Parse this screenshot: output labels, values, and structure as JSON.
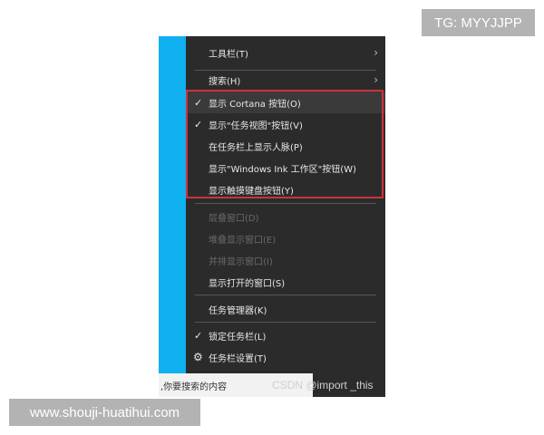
{
  "watermarks": {
    "top_right": "TG: MYYJJPP",
    "bottom_left": "www.shouji-huatihui.com",
    "csdn": "CSDN @import _this"
  },
  "menu": {
    "items": [
      {
        "label": "工具栏(T)",
        "submenu": true
      },
      {
        "label": "搜索(H)",
        "submenu": true
      },
      {
        "label": "显示 Cortana 按钮(O)",
        "checked": true
      },
      {
        "label": "显示\"任务视图\"按钮(V)",
        "checked": true
      },
      {
        "label": "在任务栏上显示人脉(P)"
      },
      {
        "label": "显示\"Windows Ink 工作区\"按钮(W)"
      },
      {
        "label": "显示触摸键盘按钮(Y)"
      },
      {
        "label": "层叠窗口(D)",
        "disabled": true
      },
      {
        "label": "堆叠显示窗口(E)",
        "disabled": true
      },
      {
        "label": "并排显示窗口(I)",
        "disabled": true
      },
      {
        "label": "显示打开的窗口(S)"
      },
      {
        "label": "任务管理器(K)"
      },
      {
        "label": "锁定任务栏(L)",
        "checked": true
      },
      {
        "label": "任务栏设置(T)",
        "icon": "gear-icon"
      }
    ],
    "highlight_color": "#d0313c"
  },
  "taskbar": {
    "search_text": ",你要搜索的内容"
  }
}
